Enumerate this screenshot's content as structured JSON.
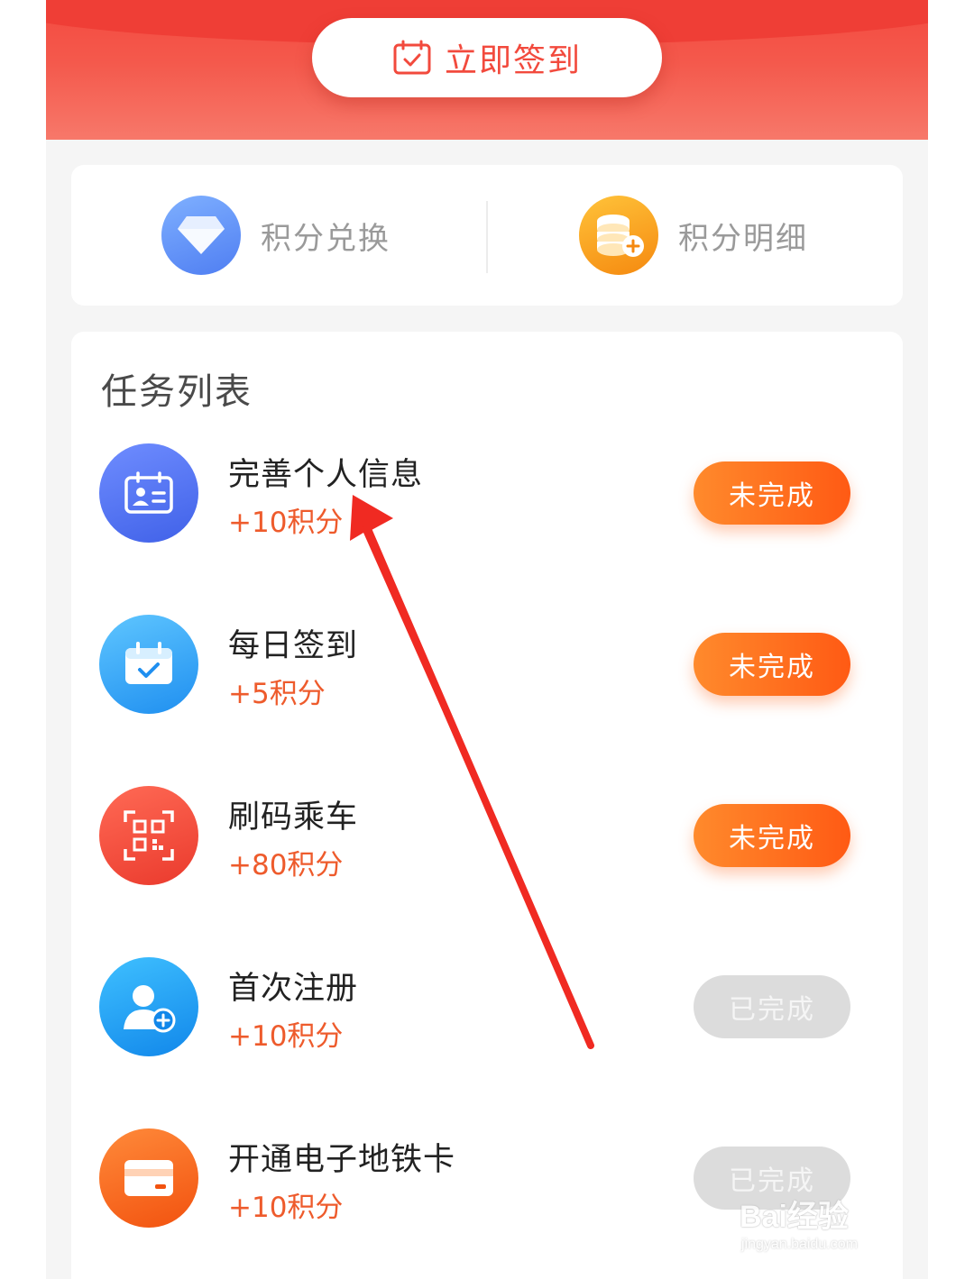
{
  "header": {
    "signin_label": "立即签到",
    "colors": {
      "primary": "#f34a40",
      "accent": "#ff5a14"
    }
  },
  "points": {
    "exchange_label": "积分兑换",
    "detail_label": "积分明细"
  },
  "tasks": {
    "title": "任务列表",
    "items": [
      {
        "name": "完善个人信息",
        "points": "+10积分",
        "status": "未完成",
        "icon": "id-card-icon",
        "done": false
      },
      {
        "name": "每日签到",
        "points": "+5积分",
        "status": "未完成",
        "icon": "calendar-check-icon",
        "done": false
      },
      {
        "name": "刷码乘车",
        "points": "+80积分",
        "status": "未完成",
        "icon": "qr-scan-icon",
        "done": false
      },
      {
        "name": "首次注册",
        "points": "+10积分",
        "status": "已完成",
        "icon": "user-add-icon",
        "done": true
      },
      {
        "name": "开通电子地铁卡",
        "points": "+10积分",
        "status": "已完成",
        "icon": "card-icon",
        "done": true
      }
    ]
  },
  "watermark": {
    "brand": "Bai经验",
    "url": "jingyan.baidu.com"
  }
}
